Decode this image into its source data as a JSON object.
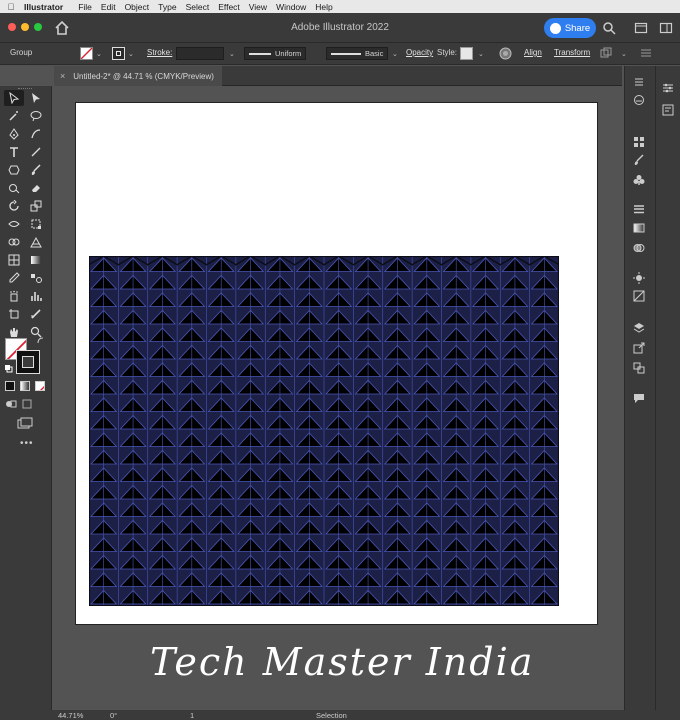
{
  "menubar": {
    "app_name": "Illustrator",
    "items": [
      "File",
      "Edit",
      "Object",
      "Type",
      "Select",
      "Effect",
      "View",
      "Window",
      "Help"
    ]
  },
  "titlebar": {
    "title": "Adobe Illustrator 2022",
    "share_label": "Share"
  },
  "controlbar": {
    "selection_type": "Group",
    "stroke_label": "Stroke:",
    "profile_label": "Uniform",
    "brush_label": "Basic",
    "opacity_label": "Opacity",
    "style_label": "Style:",
    "align_label": "Align",
    "transform_label": "Transform"
  },
  "document_tab": {
    "label": "Untitled-2* @ 44.71 % (CMYK/Preview)"
  },
  "artwork": {
    "pattern": "hexagonal triangle grid",
    "fill_color": "#1c2046",
    "line_color": "#4a57b8",
    "outline_color": "#0c0d18"
  },
  "watermark": {
    "text": "Tech Master India"
  },
  "statusbar": {
    "zoom": "44.71%",
    "rotation": "0°",
    "artboard_number": "1",
    "mode": "Selection"
  },
  "colors": {
    "accent": "#2f7ef0",
    "panel_bg": "#3a3a3a",
    "canvas_bg": "#535353"
  }
}
